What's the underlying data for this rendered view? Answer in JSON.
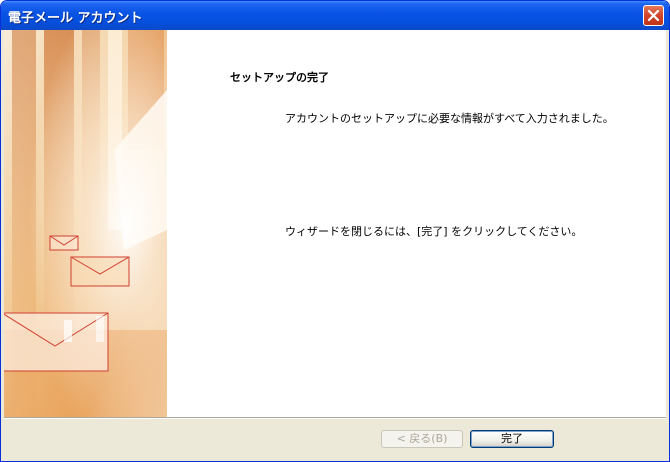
{
  "window": {
    "title": "電子メール アカウント"
  },
  "titlebar": {
    "close_icon": "close-x-icon",
    "accent_color": "#0450e0",
    "close_color": "#d0442a"
  },
  "side_panel": {
    "art_icon": "envelope-illustration"
  },
  "content": {
    "heading": "セットアップの完了",
    "message1": "アカウントのセットアップに必要な情報がすべて入力されました。",
    "message2": "ウィザードを閉じるには、[完了] をクリックしてください。"
  },
  "buttons": {
    "back_label": "< 戻る(B)",
    "back_enabled": false,
    "finish_label": "完了"
  }
}
